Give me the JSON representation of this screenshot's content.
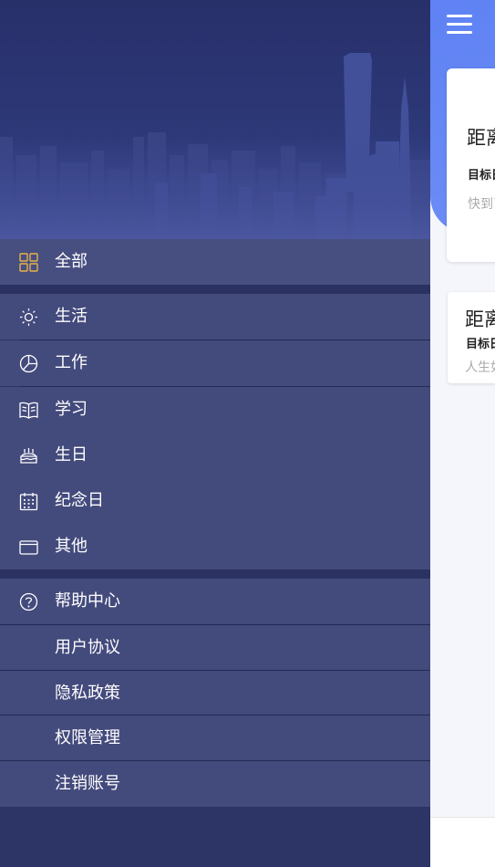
{
  "drawer": {
    "all_label": "全部",
    "categories": [
      {
        "label": "生活",
        "icon": "sun-icon"
      },
      {
        "label": "工作",
        "icon": "pie-chart-icon"
      },
      {
        "label": "学习",
        "icon": "book-icon"
      },
      {
        "label": "生日",
        "icon": "cake-icon"
      },
      {
        "label": "纪念日",
        "icon": "calendar-icon"
      },
      {
        "label": "其他",
        "icon": "folder-icon"
      }
    ],
    "help_items": [
      {
        "label": "帮助中心",
        "icon": "help-circle-icon"
      },
      {
        "label": "用户协议"
      },
      {
        "label": "隐私政策"
      },
      {
        "label": "权限管理"
      },
      {
        "label": "注销账号"
      }
    ],
    "accent_color": "#e7b24a"
  },
  "main": {
    "cards": [
      {
        "title": "距离",
        "subtitle": "目标日",
        "note": "快到了"
      },
      {
        "title": "距离",
        "subtitle": "目标日",
        "note": "人生如"
      }
    ]
  }
}
